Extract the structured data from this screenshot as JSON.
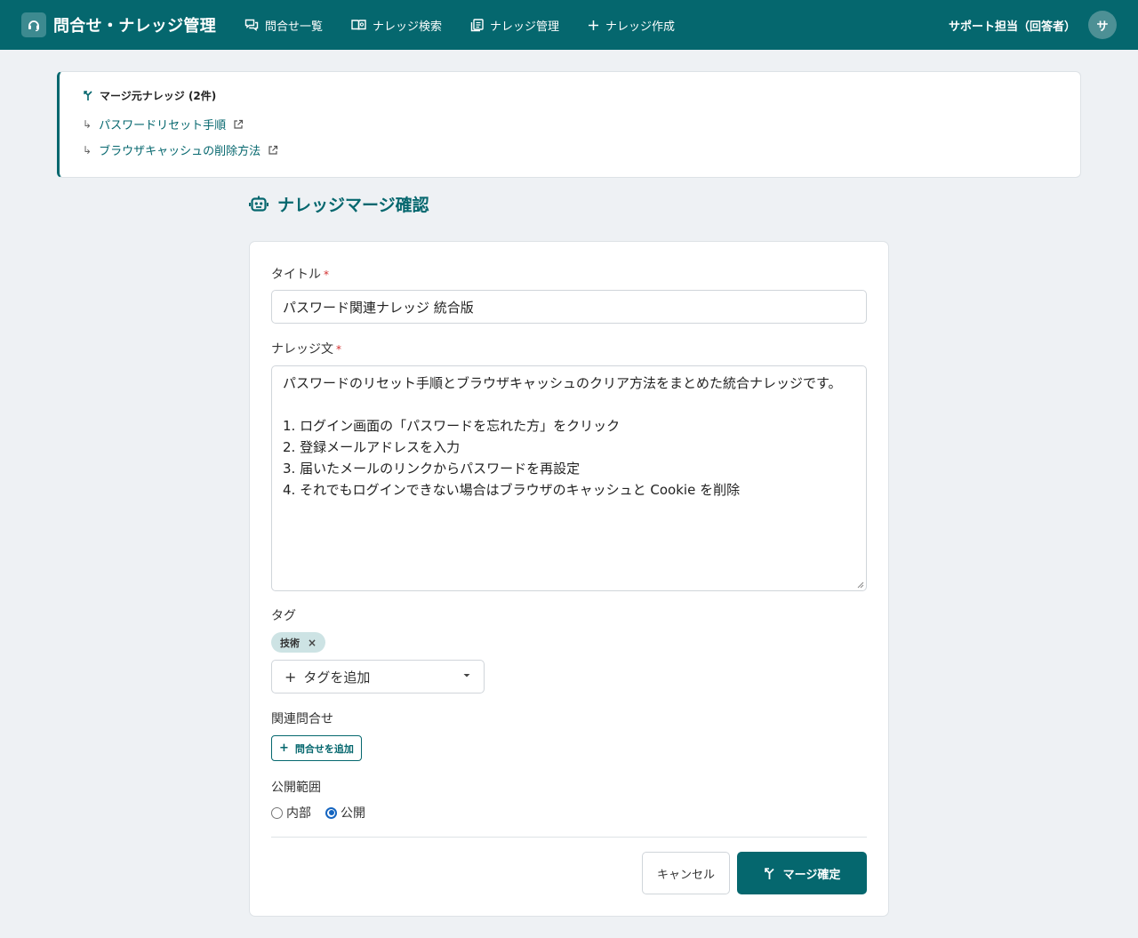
{
  "header": {
    "app_title": "問合せ・ナレッジ管理",
    "nav": [
      {
        "label": "問合せ一覧",
        "icon": "chat-list-icon"
      },
      {
        "label": "ナレッジ検索",
        "icon": "book-search-icon"
      },
      {
        "label": "ナレッジ管理",
        "icon": "documents-icon"
      },
      {
        "label": "ナレッジ作成",
        "icon": "plus-icon"
      }
    ],
    "user_name": "サポート担当（回答者）",
    "avatar_initial": "サ"
  },
  "merge_sources": {
    "title": "マージ元ナレッジ (2件)",
    "items": [
      {
        "label": "パスワードリセット手順"
      },
      {
        "label": "ブラウザキャッシュの削除方法"
      }
    ]
  },
  "page_title": "ナレッジマージ確認",
  "form": {
    "title_label": "タイトル",
    "required_mark": "*",
    "title_value": "パスワード関連ナレッジ 統合版",
    "body_label": "ナレッジ文",
    "body_value": "パスワードのリセット手順とブラウザキャッシュのクリア方法をまとめた統合ナレッジです。\n\n1. ログイン画面の「パスワードを忘れた方」をクリック\n2. 登録メールアドレスを入力\n3. 届いたメールのリンクからパスワードを再設定\n4. それでもログインできない場合はブラウザのキャッシュと Cookie を削除",
    "tag_label": "タグ",
    "tags": [
      "技術"
    ],
    "tag_remove": "×",
    "add_tag_label": "タグを追加",
    "related_label": "関連問合せ",
    "add_inquiry_label": "問合せを追加",
    "plus_symbol": "+",
    "visibility_label": "公開範囲",
    "visibility_options": [
      {
        "label": "内部",
        "checked": false
      },
      {
        "label": "公開",
        "checked": true
      }
    ],
    "cancel_label": "キャンセル",
    "confirm_label": "マージ確定"
  },
  "colors": {
    "primary": "#05676e",
    "required": "#d32f2f",
    "radio_checked": "#1565c0"
  }
}
